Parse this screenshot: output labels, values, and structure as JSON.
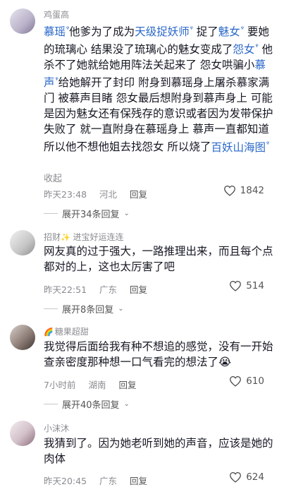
{
  "comments": [
    {
      "user": "鸡蛋高",
      "body_segments": [
        {
          "t": "慕瑶",
          "hl": true
        },
        {
          "t": "他爹为了成为",
          "hl": false
        },
        {
          "t": "天级捉妖师",
          "hl": true
        },
        {
          "t": "  捉了",
          "hl": false
        },
        {
          "t": "魅女",
          "hl": true
        },
        {
          "t": "  要她的琉璃心   结果没了琉璃心的魅女变成了",
          "hl": false
        },
        {
          "t": "怨女",
          "hl": true
        },
        {
          "t": "  他杀不了她就给她用阵法关起来了   怨女哄骗小",
          "hl": false
        },
        {
          "t": "慕声",
          "hl": true
        },
        {
          "t": "给她解开了封印   附身到慕瑶身上屠杀慕家满门  被慕声目睹  怨女最后想附身到慕声身上  可能是因为魅女还有保残存的意识或者因为发带保护失败了  就一直附身在慕瑶身上   慕声一直都知道所以他不想他姐去找怨女  所以烧了",
          "hl": false
        },
        {
          "t": "百妖山海图",
          "hl": true
        }
      ],
      "fold_label": "收起",
      "time": "昨天23:48",
      "location": "河北",
      "reply_label": "回复",
      "likes": "1842",
      "expand_label": "展开34条回复"
    },
    {
      "user": "招财",
      "user_deco": "✨",
      "user_suffix": "进宝好运连连",
      "body": "网友真的过于强大，一路推理出来，而且每个点都对的上，这也太厉害了吧",
      "time": "昨天22:51",
      "location": "广东",
      "reply_label": "回复",
      "likes": "514",
      "expand_label": "展开8条回复"
    },
    {
      "user": "糖果超甜",
      "user_deco": "🌈",
      "body": "我觉得后面给我有种不想追的感觉，没有一开始查亲密度那种想一口气看完的想法了😭",
      "time": "7小时前",
      "location": "湖南",
      "reply_label": "回复",
      "likes": "610",
      "expand_label": "展开40条回复"
    },
    {
      "user": "小沫沐",
      "body": "我猜到了。因为她老听到她的声音，应该是她的肉体",
      "time": "昨天20:45",
      "location": "广东",
      "reply_label": "回复",
      "likes": "624"
    }
  ],
  "icons": {
    "like": "heart-outline-icon",
    "search_tag": "search-tag-icon",
    "expand": "chevron-down-icon"
  },
  "colors": {
    "highlight": "#2a68c9",
    "meta": "#8a8b91",
    "text": "#161823"
  }
}
